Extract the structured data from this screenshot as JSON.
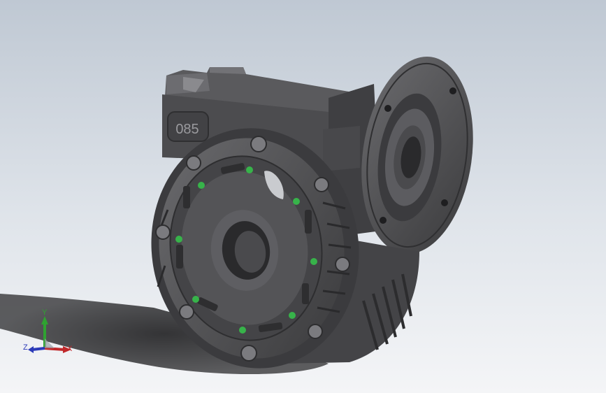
{
  "viewport": {
    "background_top": "#bfc8d3",
    "background_bottom": "#f4f5f7"
  },
  "model": {
    "housing_label": "085",
    "body_color": "#4d4d4f",
    "bolt_marker_color": "#37b34a"
  },
  "triad": {
    "x_label": "X",
    "y_label": "Y",
    "z_label": "Z",
    "x_color": "#c0282a",
    "y_color": "#2fa331",
    "z_color": "#2b3ab8"
  }
}
